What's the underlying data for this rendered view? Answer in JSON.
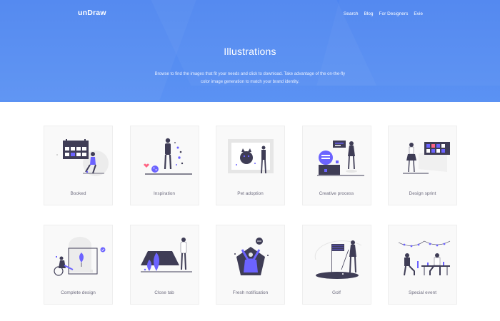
{
  "header": {
    "logo": "unDraw",
    "nav": [
      "Search",
      "Blog",
      "For Designers",
      "Evie"
    ]
  },
  "hero": {
    "title": "Illustrations",
    "description": "Browse to find the images that fit your needs and click to download. Take advantage of the on-the-fly color image generation to match your brand identity."
  },
  "colors": {
    "accent": "#6c63ff",
    "dark": "#3f3d56",
    "hero": "#4f86f0"
  },
  "cards": [
    {
      "label": "Booked",
      "icon": "booked-illustration"
    },
    {
      "label": "Inspiration",
      "icon": "inspiration-illustration"
    },
    {
      "label": "Pet adoption",
      "icon": "pet-adoption-illustration"
    },
    {
      "label": "Creative process",
      "icon": "creative-process-illustration"
    },
    {
      "label": "Design sprint",
      "icon": "design-sprint-illustration"
    },
    {
      "label": "Complete design",
      "icon": "complete-design-illustration"
    },
    {
      "label": "Close tab",
      "icon": "close-tab-illustration"
    },
    {
      "label": "Fresh notification",
      "icon": "fresh-notification-illustration"
    },
    {
      "label": "Golf",
      "icon": "golf-illustration"
    },
    {
      "label": "Special event",
      "icon": "special-event-illustration"
    }
  ]
}
